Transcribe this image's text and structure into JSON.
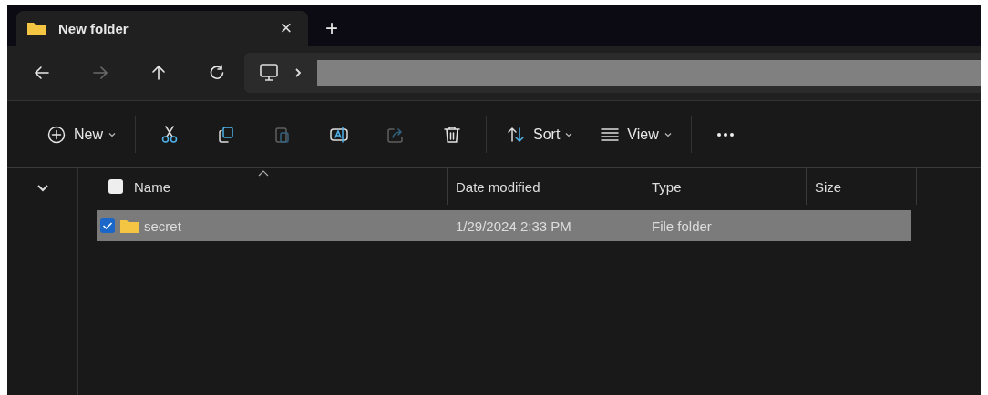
{
  "tab": {
    "title": "New folder",
    "close": "×",
    "selected": true
  },
  "new_tab": "+",
  "nav": [
    {
      "kind": "back",
      "disabled": false
    },
    {
      "kind": "forward",
      "disabled": true
    },
    {
      "kind": "up",
      "disabled": false
    },
    {
      "kind": "refresh",
      "disabled": false
    }
  ],
  "toolbar": [
    {
      "kind": "new",
      "label": "New",
      "disabled": false
    },
    {
      "kind": "cut",
      "disabled": false
    },
    {
      "kind": "copy",
      "disabled": false
    },
    {
      "kind": "paste",
      "disabled": true
    },
    {
      "kind": "rename",
      "disabled": false
    },
    {
      "kind": "share",
      "disabled": true
    },
    {
      "kind": "delete",
      "disabled": false
    },
    {
      "kind": "sort",
      "label": "Sort",
      "disabled": false
    },
    {
      "kind": "view",
      "label": "View",
      "disabled": false
    },
    {
      "kind": "more",
      "disabled": false
    }
  ],
  "table": {
    "all_checked": false,
    "columns": [
      {
        "label": "Name",
        "sorted": true
      },
      {
        "label": "Date modified",
        "sorted": false
      },
      {
        "label": "Type",
        "sorted": false
      },
      {
        "label": "Size",
        "sorted": false
      }
    ],
    "rows": [
      {
        "name": "secret",
        "date": "1/29/2024 2:33 PM",
        "type": "File folder",
        "selected": true,
        "checked": true
      }
    ]
  }
}
